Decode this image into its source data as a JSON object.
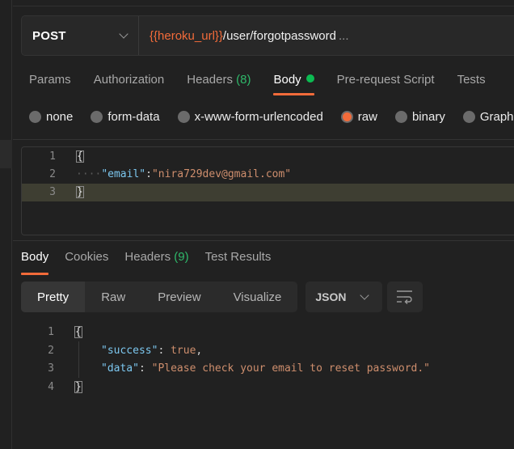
{
  "request": {
    "method": "POST",
    "url_variable": "{{heroku_url}}",
    "url_path": "/user/forgotpassword",
    "url_ellipsis": "...",
    "tabs": [
      {
        "label": "Params"
      },
      {
        "label": "Authorization"
      },
      {
        "label": "Headers",
        "count": "(8)"
      },
      {
        "label": "Body",
        "active": true,
        "indicator": "green-dot"
      },
      {
        "label": "Pre-request Script"
      },
      {
        "label": "Tests"
      }
    ],
    "body_types": [
      {
        "label": "none",
        "selected": false
      },
      {
        "label": "form-data",
        "selected": false
      },
      {
        "label": "x-www-form-urlencoded",
        "selected": false
      },
      {
        "label": "raw",
        "selected": true
      },
      {
        "label": "binary",
        "selected": false
      },
      {
        "label": "GraphQL",
        "selected": false
      }
    ],
    "body_lines": [
      {
        "n": "1",
        "open": "{"
      },
      {
        "n": "2",
        "dots": "····",
        "key": "\"email\"",
        "sep": ":",
        "value": "\"nira729dev@gmail.com\""
      },
      {
        "n": "3",
        "close": "}"
      }
    ]
  },
  "response": {
    "tabs": [
      {
        "label": "Body",
        "active": true
      },
      {
        "label": "Cookies"
      },
      {
        "label": "Headers",
        "count": "(9)"
      },
      {
        "label": "Test Results"
      }
    ],
    "view_modes": [
      "Pretty",
      "Raw",
      "Preview",
      "Visualize"
    ],
    "active_view": "Pretty",
    "format": "JSON",
    "wrap_icon": "word-wrap-icon",
    "body_lines": [
      {
        "n": "1",
        "open": "{"
      },
      {
        "n": "2",
        "key": "\"success\"",
        "sep": ": ",
        "value": "true",
        "trail": ","
      },
      {
        "n": "3",
        "key": "\"data\"",
        "sep": ": ",
        "value": "\"Please check your email to reset password.\""
      },
      {
        "n": "4",
        "close": "}"
      }
    ]
  },
  "colors": {
    "accent": "#f26b3a",
    "count_green": "#2fb86a",
    "dot_green": "#0cbb52",
    "background": "#212121"
  }
}
